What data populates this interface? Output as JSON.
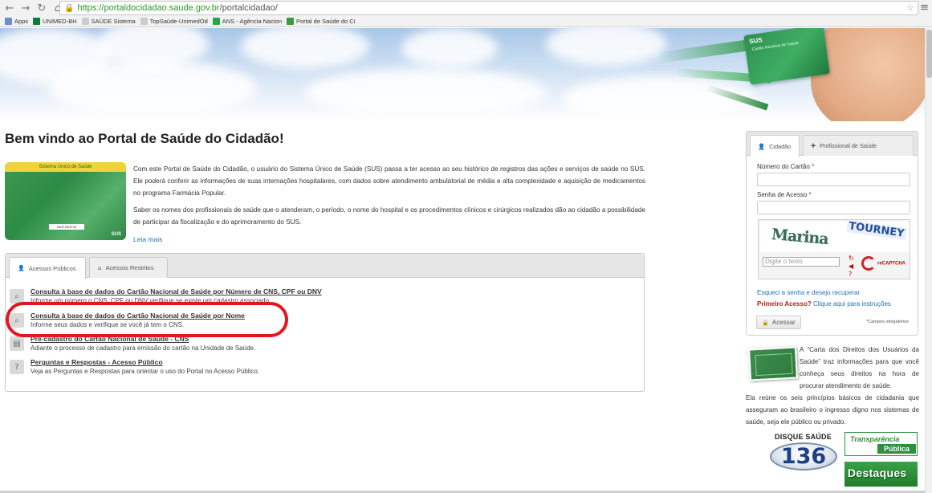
{
  "browser": {
    "url_host": "https://portaldocidadao.saude.gov.br",
    "url_path": "/portalcidadao/",
    "bookmarks": [
      {
        "label": "Apps",
        "color": "#6b8cce"
      },
      {
        "label": "UNIMED-BH",
        "color": "#0b7a3a"
      },
      {
        "label": "SAÚDE Sistema",
        "color": "#cccccc"
      },
      {
        "label": "TopSaúde-UnimedOd",
        "color": "#cccccc"
      },
      {
        "label": "ANS - Agência Nacion",
        "color": "#2aa04a"
      },
      {
        "label": "Portal de Saúde do Ci",
        "color": "#3c9a3c"
      }
    ]
  },
  "banner": {
    "card_sus": "SUS",
    "card_title": "Cartão Nacional de Saúde"
  },
  "main": {
    "title": "Bem vindo ao Portal de Saúde do Cidadão!",
    "promo_card": {
      "header": "Sistema Único de Saúde",
      "number_box": "0000 0000 00",
      "logo": "SUS"
    },
    "intro_p1": "Com este Portal de Saúde do Cidadão, o usuário do Sistema Único de Saúde (SUS) passa a ter acesso ao seu histórico de registros das ações e serviços de saúde no SUS. Ele poderá conferir as informações de suas internações hospitalares, com dados sobre atendimento ambulatorial de média e alta complexidade e aquisição de medicamentos no programa Farmácia Popular.",
    "intro_p2": "Saber os nomes dos profissionais de saúde que o atenderam, o período, o nome do hospital e os procedimentos clínicos e cirúrgicos realizados dão ao cidadão a possibilidade de participar da fiscalização e do aprimoramento do SUS.",
    "read_more": "Leia mais",
    "tabs": [
      {
        "label": "Acessos Públicos",
        "icon": "user-icon"
      },
      {
        "label": "Acessos Restritos",
        "icon": "home-icon"
      }
    ],
    "items": [
      {
        "title": "Consulta à base de dados do Cartão Nacional de Saúde por Número de CNS, CPF ou DNV",
        "desc": "Informe um número o CNS, CPF ou DNV verifique se existe um cadastro associado.",
        "icon": "search-card-icon",
        "glyph": "⌕"
      },
      {
        "title": "Consulta à base de dados do Cartão Nacional de Saúde por Nome",
        "desc": "Informe seus dados e verifique se você já tem o CNS.",
        "icon": "search-card-icon",
        "glyph": "⌕"
      },
      {
        "title": "Pré-cadastro do Cartão Nacional de Saúde - CNS",
        "desc": "Adiante o processo de cadastro para emissão do cartão na Unidade de Saúde.",
        "icon": "form-icon",
        "glyph": "▤"
      },
      {
        "title": "Perguntas e Respostas - Acesso Público",
        "desc": "Veja as Perguntas e Respostas para orientar o uso do Portal no Acesso Público.",
        "icon": "question-icon",
        "glyph": "?"
      }
    ]
  },
  "login": {
    "tabs": [
      {
        "label": "Cidadão",
        "icon": "user-icon"
      },
      {
        "label": "Profissional de Saúde",
        "icon": "plus-icon"
      }
    ],
    "card_label": "Número do Cartão",
    "password_label": "Senha de Acesso",
    "required_mark": "*",
    "captcha": {
      "word1": "Marina",
      "word2": "TOURNEY",
      "input_placeholder": "Digite o texto",
      "logo": "reCAPTCHA"
    },
    "forgot_link": "Esqueci a senha e desejo recuperar",
    "first_access_q": "Primeiro Acesso?",
    "first_access_link": "Clique aqui para instruções",
    "submit": "Acessar",
    "required_note": "*Campos obrigatórios"
  },
  "sidebar": {
    "carta_text_1": "A “Carta dos Direitos dos Usuários da Saúde” traz informações para que você conheça seus direitos na hora de procurar atendimento de saúde.",
    "carta_text_2": "Ela reúne os seis princípios básicos de cidadania que asseguram ao brasileiro o ingresso digno nos sistemas de saúde, seja ele público ou privado.",
    "disque_label": "DISQUE SAÚDE",
    "disque_number": "136",
    "transp_1": "Transparência",
    "transp_2": "Pública",
    "destaques": "Destaques"
  },
  "colors": {
    "link": "#1e73be",
    "highlight": "#e2161f",
    "sus_green": "#2f8f3f"
  }
}
